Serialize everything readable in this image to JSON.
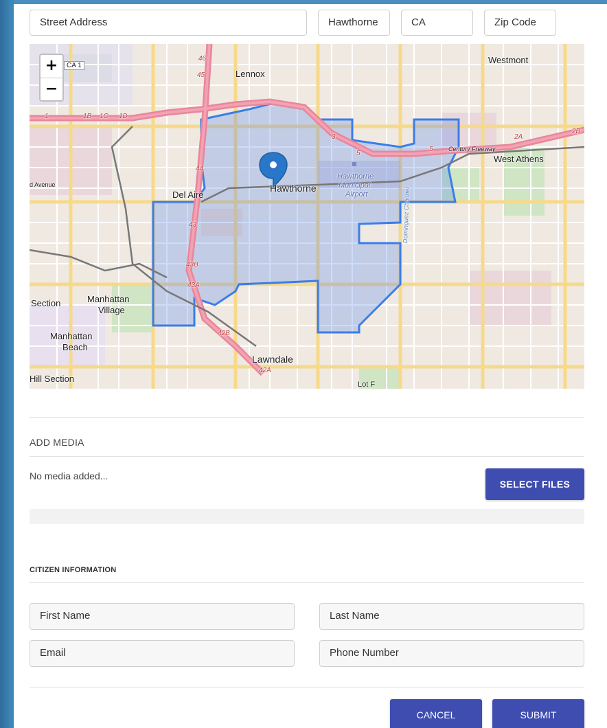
{
  "address": {
    "street_placeholder": "Street Address",
    "city_value": "Hawthorne",
    "state_value": "CA",
    "zip_placeholder": "Zip Code"
  },
  "map": {
    "zoom_in": "+",
    "zoom_out": "−",
    "labels": {
      "lennox": "Lennox",
      "westmont": "Westmont",
      "west_athens": "West Athens",
      "del_aire": "Del Aire",
      "hawthorne": "Hawthorne",
      "airport_1": "Hawthorne",
      "airport_2": "Municipal",
      "airport_3": "Airport",
      "manhattan_village_1": "Manhattan",
      "manhattan_village_2": "Village",
      "manhattan_beach_1": "Manhattan",
      "manhattan_beach_2": "Beach",
      "section": "Section",
      "hill_section": "Hill Section",
      "lawndale": "Lawndale",
      "lot_f": "Lot F",
      "avenue": "d Avenue",
      "ca1": "CA 1",
      "century_fwy": "Century Freeway",
      "dominguez": "Dominguez Channel",
      "r46": "46",
      "r45": "45",
      "r44": "44",
      "r43": "43",
      "r43b": "43B",
      "r43a": "43A",
      "r42b": "42B",
      "r42a": "42A",
      "r1b": "1B",
      "r1c": "1C",
      "r1d": "1D",
      "r1": "1",
      "r3": "3",
      "r5": "5",
      "r5b": "5",
      "r2a": "2A",
      "r2b": "2B"
    }
  },
  "media": {
    "title": "ADD MEDIA",
    "empty_text": "No media added...",
    "select_label": "SELECT FILES"
  },
  "citizen": {
    "title": "CITIZEN INFORMATION",
    "first_name_placeholder": "First Name",
    "last_name_placeholder": "Last Name",
    "email_placeholder": "Email",
    "phone_placeholder": "Phone Number"
  },
  "actions": {
    "cancel_label": "CANCEL",
    "submit_label": "SUBMIT"
  },
  "colors": {
    "primary": "#3f4db1",
    "boundary": "#3b7de8",
    "side_bar": "#3f86b8"
  }
}
